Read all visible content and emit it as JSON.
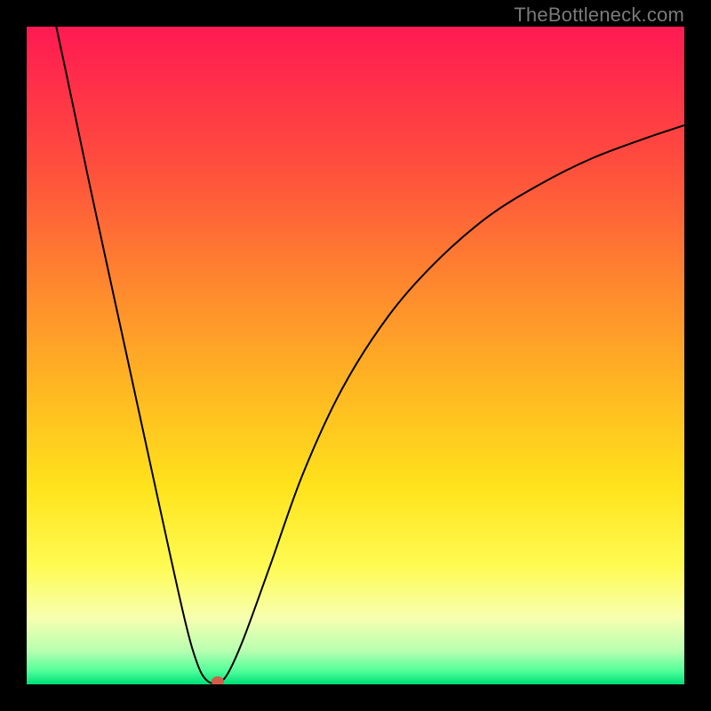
{
  "watermark": "TheBottleneck.com",
  "chart_data": {
    "type": "line",
    "title": "",
    "xlabel": "",
    "ylabel": "",
    "xlim": [
      0,
      100
    ],
    "ylim": [
      0,
      100
    ],
    "grid": false,
    "legend": false,
    "background_gradient": {
      "stops": [
        {
          "pos": 0.0,
          "color": "#ff1a52"
        },
        {
          "pos": 0.2,
          "color": "#ff4b3e"
        },
        {
          "pos": 0.4,
          "color": "#ff8a2e"
        },
        {
          "pos": 0.55,
          "color": "#ffb722"
        },
        {
          "pos": 0.7,
          "color": "#ffe31c"
        },
        {
          "pos": 0.82,
          "color": "#fffb52"
        },
        {
          "pos": 0.9,
          "color": "#f7ffb0"
        },
        {
          "pos": 0.95,
          "color": "#b7ffb0"
        },
        {
          "pos": 0.98,
          "color": "#52ff9a"
        },
        {
          "pos": 1.0,
          "color": "#00e07a"
        }
      ]
    },
    "series": [
      {
        "name": "bottleneck-curve",
        "color": "#000000",
        "stroke_width": 2,
        "points": [
          {
            "x": 4.5,
            "y": 100.0
          },
          {
            "x": 6.0,
            "y": 93.0
          },
          {
            "x": 10.0,
            "y": 74.0
          },
          {
            "x": 15.0,
            "y": 51.0
          },
          {
            "x": 20.0,
            "y": 28.0
          },
          {
            "x": 24.0,
            "y": 10.0
          },
          {
            "x": 26.0,
            "y": 3.0
          },
          {
            "x": 27.5,
            "y": 0.5
          },
          {
            "x": 29.0,
            "y": 0.3
          },
          {
            "x": 30.5,
            "y": 1.5
          },
          {
            "x": 33.0,
            "y": 7.0
          },
          {
            "x": 37.0,
            "y": 18.0
          },
          {
            "x": 42.0,
            "y": 32.0
          },
          {
            "x": 48.0,
            "y": 45.0
          },
          {
            "x": 55.0,
            "y": 56.0
          },
          {
            "x": 62.0,
            "y": 64.0
          },
          {
            "x": 70.0,
            "y": 71.0
          },
          {
            "x": 78.0,
            "y": 76.0
          },
          {
            "x": 86.0,
            "y": 80.0
          },
          {
            "x": 94.0,
            "y": 83.0
          },
          {
            "x": 100.0,
            "y": 85.0
          }
        ]
      }
    ],
    "marker": {
      "x": 29.0,
      "y": 0.4,
      "color": "#d45b49"
    }
  }
}
